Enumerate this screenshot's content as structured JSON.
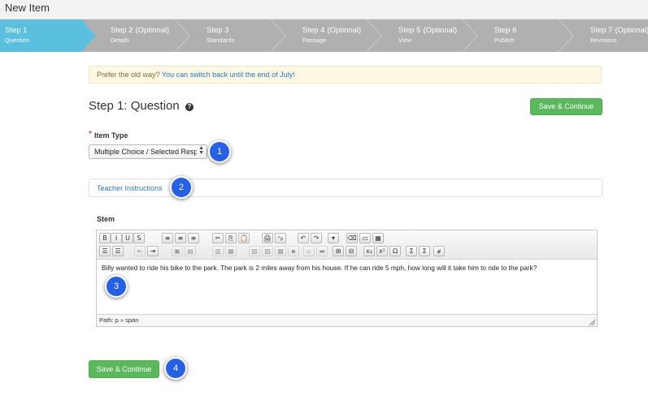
{
  "window": {
    "title": "New Item"
  },
  "wizard": {
    "steps": [
      {
        "number": "Step 1",
        "optional": "",
        "sub": "Question",
        "active": true
      },
      {
        "number": "Step 2",
        "optional": "(Optional)",
        "sub": "Details",
        "active": false
      },
      {
        "number": "Step 3",
        "optional": "",
        "sub": "Standards",
        "active": false
      },
      {
        "number": "Step 4",
        "optional": "(Optional)",
        "sub": "Passage",
        "active": false
      },
      {
        "number": "Step 5",
        "optional": "(Optional)",
        "sub": "View",
        "active": false
      },
      {
        "number": "Step 6",
        "optional": "",
        "sub": "Publish",
        "active": false
      },
      {
        "number": "Step 7",
        "optional": "(Optional)",
        "sub": "Revisions",
        "active": false
      }
    ],
    "colors": {
      "active": "#5bc0de",
      "inactive": "#b0b0b0"
    }
  },
  "banner": {
    "text": "Prefer the old way? ",
    "link": "You can switch back until the end of July!"
  },
  "page": {
    "title": "Step 1: Question",
    "help_icon": "?",
    "save_top": "Save & Continue",
    "save_bottom": "Save & Continue"
  },
  "form": {
    "required_mark": "*",
    "item_type_label": "Item Type",
    "item_type_value": "Multiple Choice / Selected Resp",
    "teacher_instructions": "Teacher Instructions",
    "stem_label": "Stem",
    "stem_text": "Billy wanted to ride his bike to the park. The park is 2 miles away from his house. If he can ride 5 mph, how long will it take him to ride to the park?",
    "path_text": "Path: p » span"
  },
  "markers": [
    "1",
    "2",
    "3",
    "4"
  ],
  "toolbar": {
    "row1": [
      "B",
      "I",
      "U",
      "S",
      "≡",
      "≡",
      "≡",
      "✂",
      "⎘",
      "📋",
      "🖨",
      "ᴬᵦ",
      "↶",
      "↷",
      "▾",
      "⌫",
      "▭",
      "▦"
    ],
    "row2": [
      "☰",
      "☰",
      "⇤",
      "⇥",
      "▣",
      "▤",
      "▥",
      "▦",
      "▧",
      "▨",
      "▩",
      "▪",
      "▫",
      "▬",
      "⊞",
      "⊟",
      "x₂",
      "x²",
      "Ω",
      "Σ",
      "Σ",
      "⧣"
    ]
  }
}
